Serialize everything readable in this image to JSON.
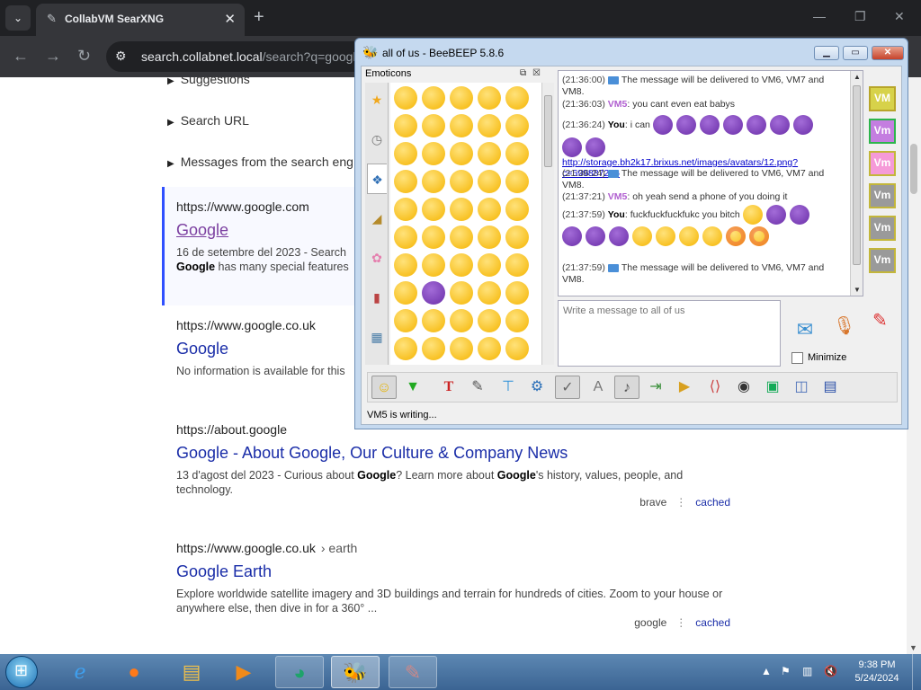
{
  "chrome": {
    "tab_title": "CollabVM SearXNG",
    "url_host": "search.collabnet.local",
    "url_rest": "/search?q=googl"
  },
  "page": {
    "collapsibles": [
      "Suggestions",
      "Search URL",
      "Messages from the search eng"
    ],
    "results": [
      {
        "url": "https://www.google.com",
        "title": "Google",
        "desc_1": "16 de setembre del 2023 - Search",
        "desc_2_bold": "Google",
        "desc_2_rest": " has many special features"
      },
      {
        "url": "https://www.google.co.uk",
        "title": "Google",
        "desc": "No information is available for this"
      },
      {
        "url": "https://about.google",
        "title": "Google - About Google, Our Culture & Company News",
        "desc_a": "13 d'agost del 2023 - Curious about ",
        "desc_b": "Google",
        "desc_c": "? Learn more about ",
        "desc_d": "Google",
        "desc_e": "'s history, values, people, and technology.",
        "engine": "brave",
        "cached": "cached"
      },
      {
        "url": "https://www.google.co.uk",
        "url_path": "› earth",
        "title": "Google Earth",
        "desc": "Explore worldwide satellite imagery and 3D buildings and terrain for hundreds of cities. Zoom to your house or anywhere else, then dive in for a 360° ...",
        "engine": "google",
        "cached": "cached"
      }
    ]
  },
  "beebeep": {
    "title": "all of us - BeeBEEP 5.8.6",
    "emoticons_title": "Emoticons",
    "chat": [
      {
        "ts": "(21:36:00)",
        "text": "The message will be delivered to VM6, VM7 and VM8."
      },
      {
        "ts": "(21:36:03)",
        "user": "VM5",
        "text": ": you cant even eat babys"
      },
      {
        "ts": "(21:36:24)",
        "user": "You",
        "text": ": i can"
      },
      {
        "link": "http://storage.bh2k17.brixus.net/images/avatars/12.png?c=599887236"
      },
      {
        "ts": "(21:36:24)",
        "text": "The message will be delivered to VM6, VM7 and VM8."
      },
      {
        "ts": "(21:37:21)",
        "user": "VM5",
        "text": ": oh yeah send a phone of you doing it"
      },
      {
        "ts": "(21:37:59)",
        "user": "You",
        "text": ": fuckfuckfuckfukc you bitch"
      },
      {
        "ts": "(21:37:59)",
        "text": "The message will be delivered to VM6, VM7 and VM8."
      }
    ],
    "input_placeholder": "Write a message to all of us",
    "minimize_label": "Minimize",
    "vm_first": "VM",
    "vm_label": "Vm",
    "status": "VM5 is writing..."
  },
  "taskbar": {
    "time": "9:38 PM",
    "date": "5/24/2024"
  }
}
